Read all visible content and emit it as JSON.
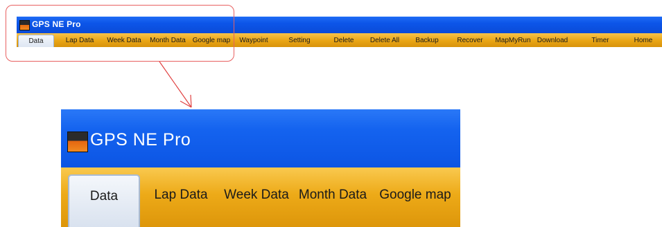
{
  "window": {
    "title": "GPS NE Pro",
    "icon": "app-logo-icon"
  },
  "tabs": [
    {
      "label": "Data",
      "active": true
    },
    {
      "label": "Lap Data"
    },
    {
      "label": "Week Data"
    },
    {
      "label": "Month Data"
    },
    {
      "label": "Google map"
    },
    {
      "label": "Waypoint"
    },
    {
      "label": "Setting"
    },
    {
      "label": "Delete"
    },
    {
      "label": "Delete All"
    },
    {
      "label": "Backup"
    },
    {
      "label": "Recover"
    },
    {
      "label": "MapMyRun"
    },
    {
      "label": "Download"
    },
    {
      "label": "Timer"
    },
    {
      "label": "Home"
    }
  ],
  "zoom": {
    "title": "GPS NE Pro",
    "tabs": [
      "Data",
      "Lap Data",
      "Week Data",
      "Month Data",
      "Google map"
    ]
  },
  "colors": {
    "titlebar": "#0c55e8",
    "tabbar": "#e9a515",
    "callout": "#e86060"
  }
}
